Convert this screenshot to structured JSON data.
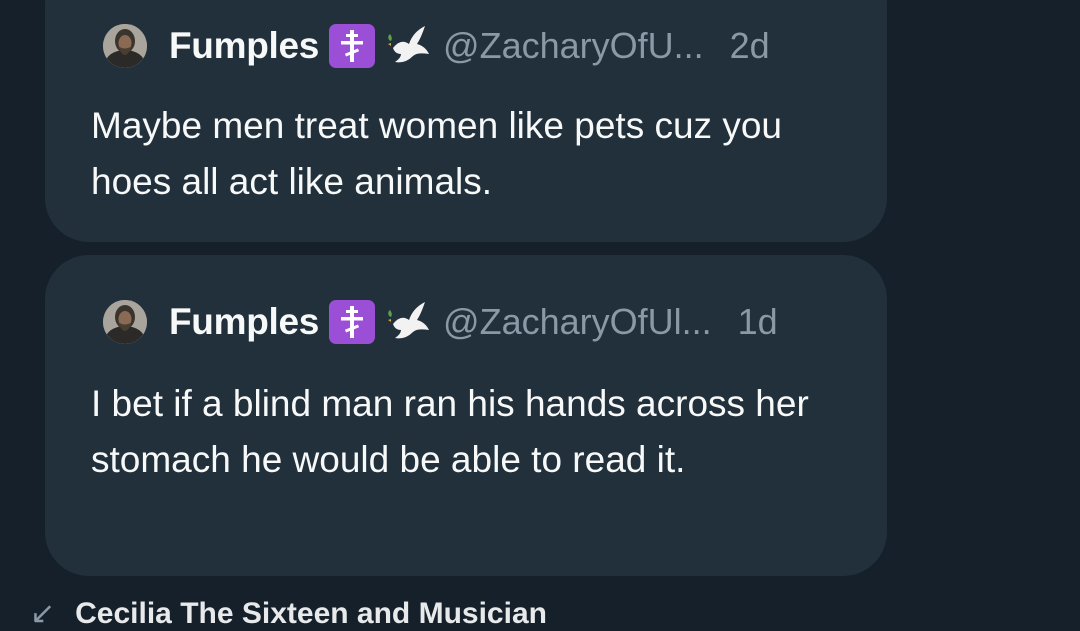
{
  "colors": {
    "background": "#15202b",
    "card": "#22303c",
    "text": "#f7f9f9",
    "muted": "#8b98a5",
    "badge": "#9b4fd6"
  },
  "replies": [
    {
      "display_name": "Fumples",
      "handle": "@ZacharyOfU...",
      "time": "2d",
      "text": "Maybe men treat women like pets cuz you hoes all act like animals.",
      "icons": [
        "avatar",
        "orthodox-cross-icon",
        "dove-icon"
      ]
    },
    {
      "display_name": "Fumples",
      "handle": "@ZacharyOfUl...",
      "time": "1d",
      "text": "I bet if a blind man ran his hands across her stomach he would be able to read it.",
      "icons": [
        "avatar",
        "orthodox-cross-icon",
        "dove-icon"
      ]
    }
  ],
  "bottom": {
    "text": "Cecilia The Sixteen and Musician",
    "icon": "reply-arrow-icon"
  }
}
